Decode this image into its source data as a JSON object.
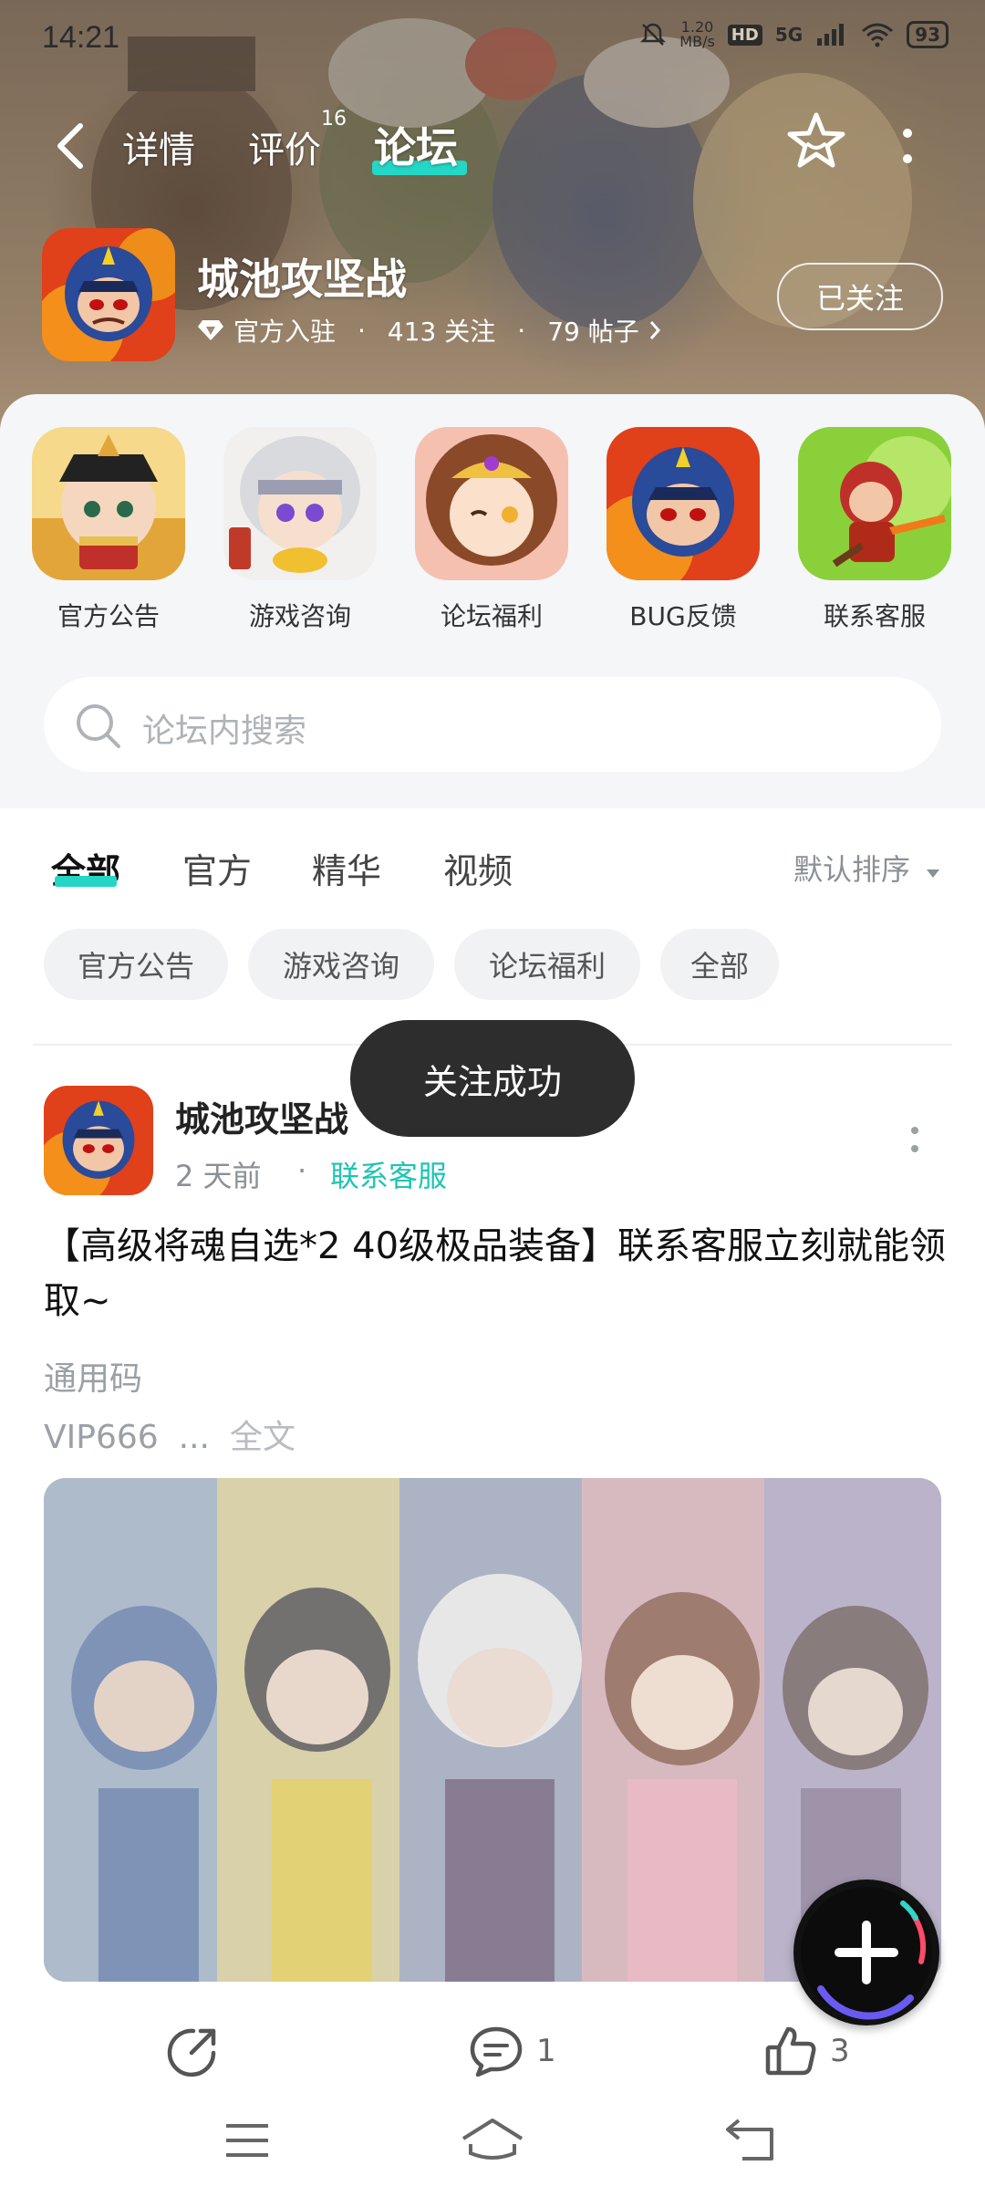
{
  "status_bar": {
    "time": "14:21",
    "net_speed_value": "1.20",
    "net_speed_unit": "MB/s",
    "hd": "HD",
    "signal": "5G",
    "battery": "93"
  },
  "nav": {
    "tabs": [
      {
        "label": "详情"
      },
      {
        "label": "评价",
        "badge": "16"
      },
      {
        "label": "论坛"
      }
    ],
    "active_tab": "论坛",
    "accent_color": "#24d6c6"
  },
  "game": {
    "title": "城池攻坚战",
    "official": "官方入驻",
    "followers": "413 关注",
    "posts": "79 帖子",
    "follow_button": "已关注"
  },
  "shortcuts": [
    {
      "label": "官方公告"
    },
    {
      "label": "游戏咨询"
    },
    {
      "label": "论坛福利"
    },
    {
      "label": "BUG反馈"
    },
    {
      "label": "联系客服"
    }
  ],
  "search": {
    "placeholder": "论坛内搜索"
  },
  "filter_tabs": [
    {
      "label": "全部"
    },
    {
      "label": "官方"
    },
    {
      "label": "精华"
    },
    {
      "label": "视频"
    }
  ],
  "sort": {
    "label": "默认排序"
  },
  "chips": [
    {
      "label": "官方公告"
    },
    {
      "label": "游戏咨询"
    },
    {
      "label": "论坛福利"
    },
    {
      "label": "全部"
    }
  ],
  "toast": "关注成功",
  "post": {
    "author": "城池攻坚战",
    "time": "2 天前",
    "separator": "·",
    "category": "联系客服",
    "title": "【高级将魂自选*2 40级极品装备】联系客服立刻就能领取~",
    "body_line1": "通用码",
    "body_line2": "VIP666",
    "ellipsis": "...",
    "full_text": "全文",
    "share_count": "",
    "comment_count": "1",
    "like_count": "3"
  }
}
